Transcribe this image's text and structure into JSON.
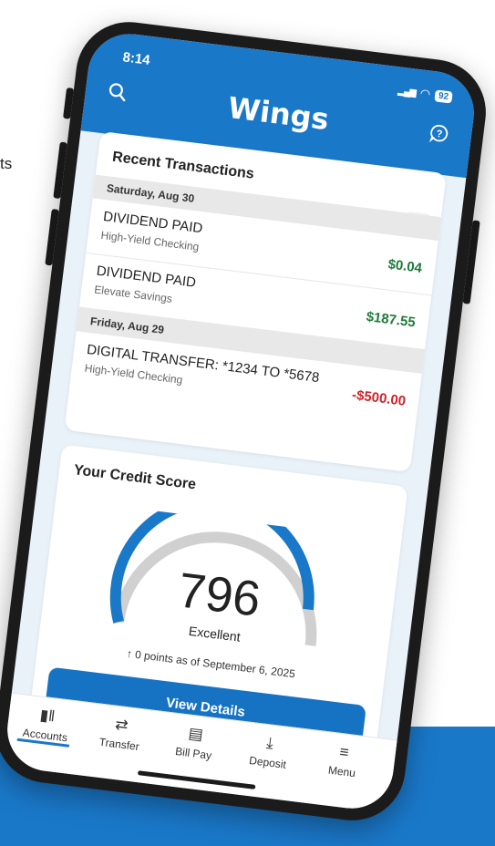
{
  "background": {
    "stray_text": "ts"
  },
  "status_bar": {
    "time": "8:14",
    "battery": "92"
  },
  "header": {
    "app_name": "Wings"
  },
  "transactions": {
    "title": "Recent Transactions",
    "more_label": "...",
    "groups": [
      {
        "date": "Saturday, Aug 30",
        "items": [
          {
            "title": "DIVIDEND PAID",
            "account": "High-Yield Checking",
            "amount": "$0.04"
          },
          {
            "title": "DIVIDEND PAID",
            "account": "Elevate Savings",
            "amount": "$187.55"
          }
        ]
      },
      {
        "date": "Friday, Aug 29",
        "items": [
          {
            "title": "DIGITAL TRANSFER: *1234 TO *5678",
            "account": "High-Yield Checking",
            "amount": "-$500.00"
          }
        ]
      }
    ]
  },
  "credit": {
    "title": "Your Credit Score",
    "score": "796",
    "rating": "Excellent",
    "gauge_fraction": 0.88,
    "points_text": "↑ 0 points as of September 6, 2025",
    "button_label": "View Details"
  },
  "nav": {
    "tabs": [
      {
        "label": "Accounts",
        "icon": "accounts-icon",
        "glyph": "▮‖"
      },
      {
        "label": "Transfer",
        "icon": "transfer-icon",
        "glyph": "⇄"
      },
      {
        "label": "Bill Pay",
        "icon": "bill-pay-icon",
        "glyph": "▤"
      },
      {
        "label": "Deposit",
        "icon": "deposit-icon",
        "glyph": "⤓"
      },
      {
        "label": "Menu",
        "icon": "menu-icon",
        "glyph": "≡"
      }
    ]
  },
  "colors": {
    "brand": "#1a78c9",
    "positive": "#1e7a3a",
    "negative": "#d0202a",
    "gauge_track": "#d0d0d0"
  }
}
